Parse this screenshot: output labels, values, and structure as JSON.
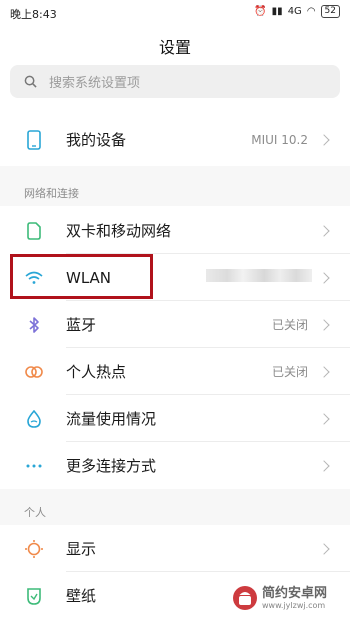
{
  "status": {
    "time": "晚上8:43",
    "network": "4G",
    "battery": "52"
  },
  "title": "设置",
  "search": {
    "placeholder": "搜索系统设置项"
  },
  "device": {
    "label": "我的设备",
    "value": "MIUI 10.2"
  },
  "sections": {
    "network": "网络和连接",
    "personal": "个人"
  },
  "network_items": [
    {
      "label": "双卡和移动网络",
      "value": ""
    },
    {
      "label": "WLAN",
      "value": ""
    },
    {
      "label": "蓝牙",
      "value": "已关闭"
    },
    {
      "label": "个人热点",
      "value": "已关闭"
    },
    {
      "label": "流量使用情况",
      "value": ""
    },
    {
      "label": "更多连接方式",
      "value": ""
    }
  ],
  "personal_items": [
    {
      "label": "显示"
    },
    {
      "label": "壁纸"
    }
  ],
  "watermark": {
    "name": "简约安卓网",
    "url": "www.jylzwj.com"
  },
  "colors": {
    "accent": "#29a6d6",
    "highlight": "#b0121b",
    "sim": "#3dbb79",
    "bluetooth": "#7d72d8",
    "hotspot": "#f08a4b",
    "display": "#f08a4b",
    "wallpaper": "#3dbb79"
  }
}
